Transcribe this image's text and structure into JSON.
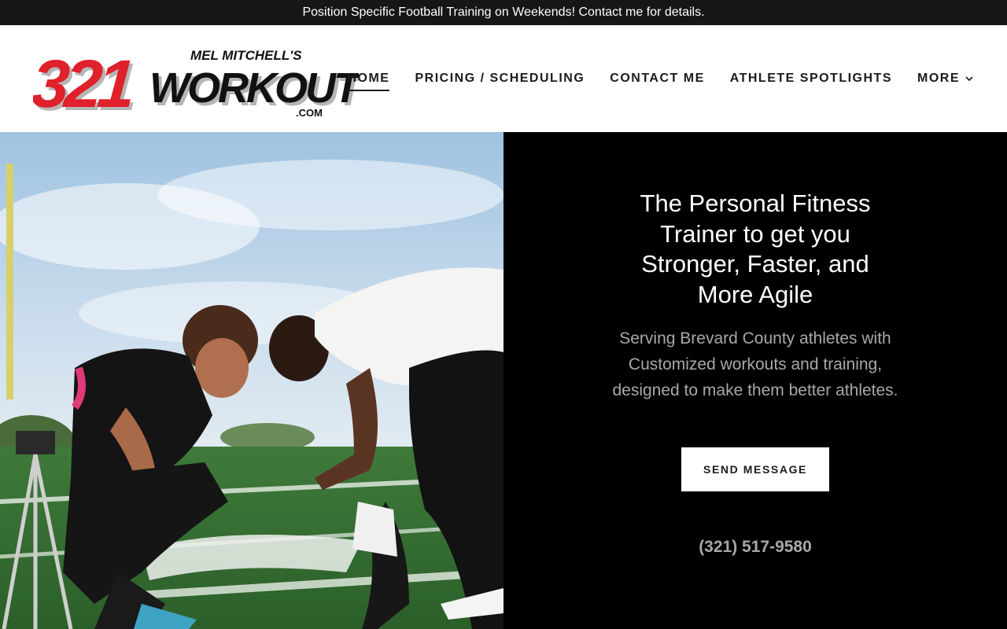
{
  "announcement": {
    "text": "Position Specific Football Training on Weekends! Contact me for details."
  },
  "logo": {
    "top_line": "MEL MITCHELL'S",
    "number": "321",
    "word": "WORKOUT",
    "suffix": ".COM",
    "colors": {
      "number": "#e0202a",
      "word": "#111111",
      "shadow": "#b5b5b5"
    }
  },
  "nav": {
    "items": [
      {
        "label": "HOME",
        "active": true
      },
      {
        "label": "PRICING / SCHEDULING",
        "active": false
      },
      {
        "label": "CONTACT ME",
        "active": false
      },
      {
        "label": "ATHLETE SPOTLIGHTS",
        "active": false
      }
    ],
    "more_label": "MORE",
    "more_icon": "chevron-down-icon"
  },
  "hero": {
    "headline": "The Personal Fitness Trainer to get you Stronger, Faster, and More Agile",
    "subtext": "Serving Brevard County athletes with Customized workouts and training, designed to make them better athletes.",
    "cta_label": "SEND MESSAGE",
    "phone": "(321) 517-9580",
    "colors": {
      "panel": "#000000",
      "headline": "#ffffff",
      "subtext": "#a8a8a8",
      "button_bg": "#ffffff"
    }
  }
}
